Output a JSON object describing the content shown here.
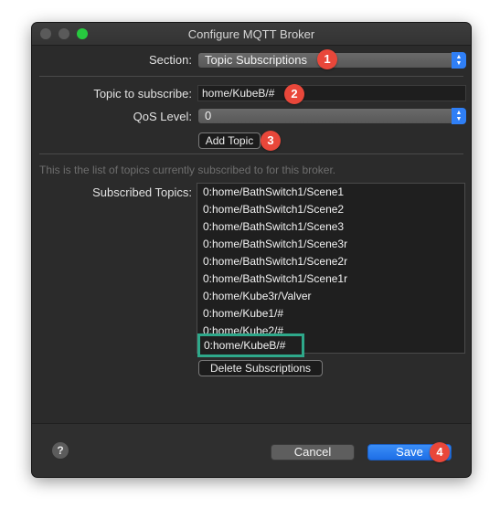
{
  "window": {
    "title": "Configure MQTT Broker"
  },
  "section": {
    "label": "Section:",
    "value": "Topic Subscriptions"
  },
  "topic": {
    "label": "Topic to subscribe:",
    "value": "home/KubeB/#"
  },
  "qos": {
    "label": "QoS Level:",
    "value": "0"
  },
  "add_topic_label": "Add Topic",
  "info_text": "This is the list of topics currently subscribed to for this broker.",
  "subscribed": {
    "label": "Subscribed Topics:",
    "items": [
      "0:home/BathSwitch1/Scene1",
      "0:home/BathSwitch1/Scene2",
      "0:home/BathSwitch1/Scene3",
      "0:home/BathSwitch1/Scene3r",
      "0:home/BathSwitch1/Scene2r",
      "0:home/BathSwitch1/Scene1r",
      "0:home/Kube3r/Valver",
      "0:home/Kube1/#",
      "0:home/Kube2/#"
    ],
    "highlighted_item": "0:home/KubeB/#"
  },
  "delete_label": "Delete Subscriptions",
  "footer": {
    "help": "?",
    "cancel": "Cancel",
    "save": "Save"
  },
  "badges": [
    "1",
    "2",
    "3",
    "4"
  ],
  "colors": {
    "accent": "#2f7ff6",
    "badge": "#e9473a",
    "highlight": "#2ea88a"
  }
}
